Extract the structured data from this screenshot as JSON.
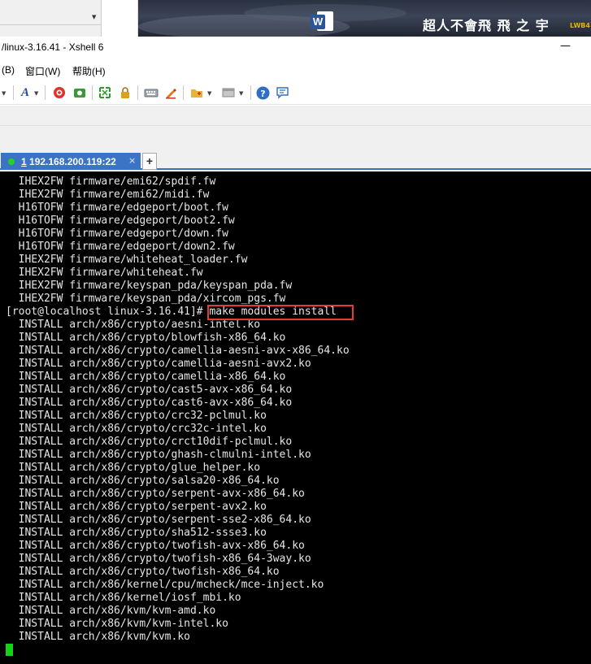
{
  "desktop": {
    "photo_caption": "超人不會飛  飛 之 宇",
    "photo_badge": "LWB4"
  },
  "window": {
    "title": "/linux-3.16.41 - Xshell 6",
    "minimize_symbol": "—"
  },
  "menu": {
    "items": [
      "(B)",
      "窗口(W)",
      "帮助(H)"
    ]
  },
  "tab": {
    "number": "1",
    "host": " 192.168.200.119:22",
    "close_symbol": "×",
    "new_tab_symbol": "+"
  },
  "terminal": {
    "prompt": "[root@localhost linux-3.16.41]#",
    "command": " make modules install",
    "lines": [
      "  IHEX2FW firmware/emi62/spdif.fw",
      "  IHEX2FW firmware/emi62/midi.fw",
      "  H16TOFW firmware/edgeport/boot.fw",
      "  H16TOFW firmware/edgeport/boot2.fw",
      "  H16TOFW firmware/edgeport/down.fw",
      "  H16TOFW firmware/edgeport/down2.fw",
      "  IHEX2FW firmware/whiteheat_loader.fw",
      "  IHEX2FW firmware/whiteheat.fw",
      "  IHEX2FW firmware/keyspan_pda/keyspan_pda.fw",
      "  IHEX2FW firmware/keyspan_pda/xircom_pgs.fw",
      "[root@localhost linux-3.16.41]# make modules install",
      "  INSTALL arch/x86/crypto/aesni-intel.ko",
      "  INSTALL arch/x86/crypto/blowfish-x86_64.ko",
      "  INSTALL arch/x86/crypto/camellia-aesni-avx-x86_64.ko",
      "  INSTALL arch/x86/crypto/camellia-aesni-avx2.ko",
      "  INSTALL arch/x86/crypto/camellia-x86_64.ko",
      "  INSTALL arch/x86/crypto/cast5-avx-x86_64.ko",
      "  INSTALL arch/x86/crypto/cast6-avx-x86_64.ko",
      "  INSTALL arch/x86/crypto/crc32-pclmul.ko",
      "  INSTALL arch/x86/crypto/crc32c-intel.ko",
      "  INSTALL arch/x86/crypto/crct10dif-pclmul.ko",
      "  INSTALL arch/x86/crypto/ghash-clmulni-intel.ko",
      "  INSTALL arch/x86/crypto/glue_helper.ko",
      "  INSTALL arch/x86/crypto/salsa20-x86_64.ko",
      "  INSTALL arch/x86/crypto/serpent-avx-x86_64.ko",
      "  INSTALL arch/x86/crypto/serpent-avx2.ko",
      "  INSTALL arch/x86/crypto/serpent-sse2-x86_64.ko",
      "  INSTALL arch/x86/crypto/sha512-ssse3.ko",
      "  INSTALL arch/x86/crypto/twofish-avx-x86_64.ko",
      "  INSTALL arch/x86/crypto/twofish-x86_64-3way.ko",
      "  INSTALL arch/x86/crypto/twofish-x86_64.ko",
      "  INSTALL arch/x86/kernel/cpu/mcheck/mce-inject.ko",
      "  INSTALL arch/x86/kernel/iosf_mbi.ko",
      "  INSTALL arch/x86/kvm/kvm-amd.ko",
      "  INSTALL arch/x86/kvm/kvm-intel.ko",
      "  INSTALL arch/x86/kvm/kvm.ko"
    ]
  },
  "colors": {
    "tab_active": "#3b74c4",
    "terminal_bg": "#000000",
    "terminal_fg": "#e6e6e6",
    "cursor": "#14d314",
    "highlight_box": "#e33b3b"
  }
}
